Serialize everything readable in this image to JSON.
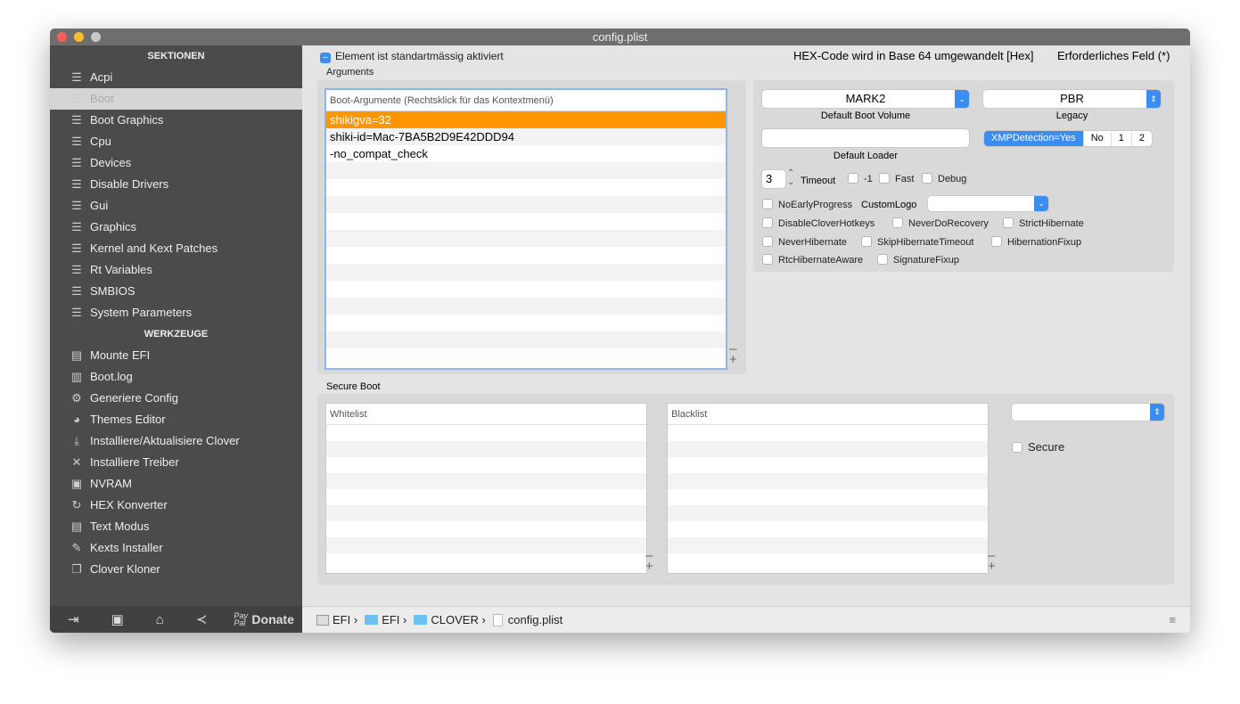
{
  "window": {
    "title": "config.plist"
  },
  "sidebar": {
    "section_header": "SEKTIONEN",
    "sections": [
      {
        "label": "Acpi"
      },
      {
        "label": "Boot",
        "selected": true
      },
      {
        "label": "Boot Graphics"
      },
      {
        "label": "Cpu"
      },
      {
        "label": "Devices"
      },
      {
        "label": "Disable Drivers"
      },
      {
        "label": "Gui"
      },
      {
        "label": "Graphics"
      },
      {
        "label": "Kernel and Kext Patches"
      },
      {
        "label": "Rt Variables"
      },
      {
        "label": "SMBIOS"
      },
      {
        "label": "System Parameters"
      }
    ],
    "tools_header": "WERKZEUGE",
    "tools": [
      {
        "label": "Mounte EFI",
        "icon": "disk-icon"
      },
      {
        "label": "Boot.log",
        "icon": "log-icon"
      },
      {
        "label": "Generiere Config",
        "icon": "gears-icon"
      },
      {
        "label": "Themes Editor",
        "icon": "palette-icon"
      },
      {
        "label": "Installiere/Aktualisiere Clover",
        "icon": "download-icon"
      },
      {
        "label": "Installiere Treiber",
        "icon": "wrench-icon"
      },
      {
        "label": "NVRAM",
        "icon": "chip-icon"
      },
      {
        "label": "HEX Konverter",
        "icon": "refresh-icon"
      },
      {
        "label": "Text Modus",
        "icon": "text-icon"
      },
      {
        "label": "Kexts Installer",
        "icon": "plug-icon"
      },
      {
        "label": "Clover Kloner",
        "icon": "copy-icon"
      }
    ],
    "footer": {
      "donate": "Donate",
      "paypal": "PayPal"
    }
  },
  "top": {
    "enabled_label": "Element ist standartmässig aktiviert",
    "hex_note": "HEX-Code wird in Base 64 umgewandelt [Hex]",
    "required_note": "Erforderliches Feld (*)"
  },
  "arguments": {
    "title": "Arguments",
    "header": "Boot-Argumente (Rechtsklick für das Kontextmenü)",
    "items": [
      "shikigva=32",
      "shiki-id=Mac-7BA5B2D9E42DDD94",
      "-no_compat_check"
    ],
    "selected_color": "#ff9500"
  },
  "boot": {
    "default_volume": "MARK2",
    "default_volume_label": "Default Boot Volume",
    "legacy": "PBR",
    "legacy_label": "Legacy",
    "default_loader": "",
    "default_loader_label": "Default Loader",
    "xmp": [
      "XMPDetection=Yes",
      "No",
      "1",
      "2"
    ],
    "timeout": "3",
    "timeout_label": "Timeout",
    "custom_logo_label": "CustomLogo",
    "checks": {
      "minus1": "-1",
      "fast": "Fast",
      "debug": "Debug",
      "noearly": "NoEarlyProgress",
      "disablehk": "DisableCloverHotkeys",
      "neverrec": "NeverDoRecovery",
      "stricthib": "StrictHibernate",
      "neverhib": "NeverHibernate",
      "skiphib": "SkipHibernateTimeout",
      "hibfix": "HibernationFixup",
      "rtchib": "RtcHibernateAware",
      "sigfix": "SignatureFixup"
    }
  },
  "secure_boot": {
    "title": "Secure Boot",
    "whitelist": "Whitelist",
    "blacklist": "Blacklist",
    "secure_label": "Secure"
  },
  "path": {
    "items": [
      "EFI",
      "EFI",
      "CLOVER",
      "config.plist"
    ]
  }
}
